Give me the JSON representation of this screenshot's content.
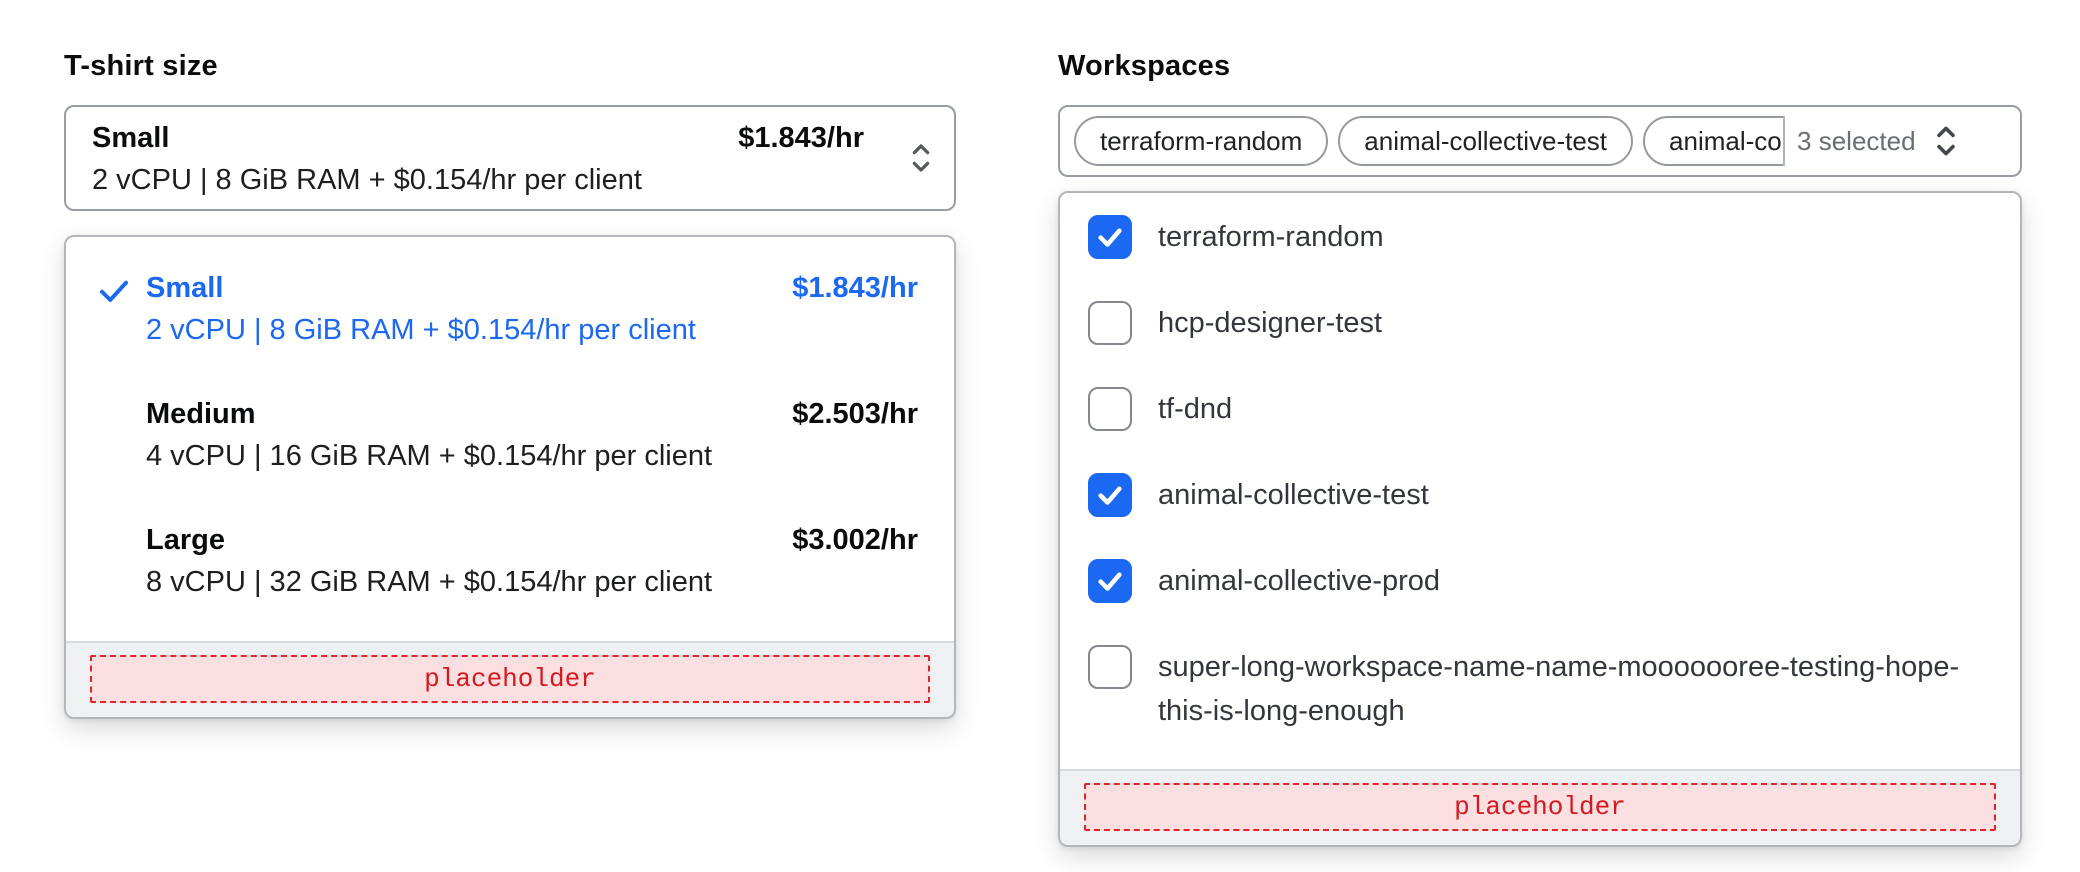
{
  "tshirt": {
    "label": "T-shirt size",
    "trigger": {
      "title": "Small",
      "price": "$1.843/hr",
      "subtitle": "2 vCPU | 8 GiB RAM + $0.154/hr per client"
    },
    "options": [
      {
        "title": "Small",
        "price": "$1.843/hr",
        "subtitle": "2 vCPU | 8 GiB RAM + $0.154/hr per client",
        "selected": true
      },
      {
        "title": "Medium",
        "price": "$2.503/hr",
        "subtitle": "4 vCPU | 16 GiB RAM + $0.154/hr per client",
        "selected": false
      },
      {
        "title": "Large",
        "price": "$3.002/hr",
        "subtitle": "8 vCPU | 32 GiB RAM + $0.154/hr per client",
        "selected": false
      }
    ],
    "footer_placeholder": "placeholder"
  },
  "workspaces": {
    "label": "Workspaces",
    "trigger": {
      "chips": [
        "terraform-random",
        "animal-collective-test",
        "animal-co"
      ],
      "count_label": "3 selected"
    },
    "options": [
      {
        "label": "terraform-random",
        "checked": true
      },
      {
        "label": "hcp-designer-test",
        "checked": false
      },
      {
        "label": "tf-dnd",
        "checked": false
      },
      {
        "label": "animal-collective-test",
        "checked": true
      },
      {
        "label": "animal-collective-prod",
        "checked": true
      },
      {
        "label": "super-long-workspace-name-name-mooooooree-testing-hope-this-is-long-enough",
        "checked": false
      }
    ],
    "footer_placeholder": "placeholder"
  },
  "icons": {
    "trigger_caret": "unfold-more-icon",
    "selected_option": "check-icon",
    "checked_box": "check-icon"
  },
  "colors": {
    "accent_blue": "#1b68f2",
    "placeholder_border_red": "#e0252c",
    "placeholder_text_red": "#d6191f",
    "placeholder_bg_pink": "#fbdfe1",
    "footer_bg": "#eef0f2",
    "trigger_border": "#989ca3",
    "panel_border": "#b3b6bb",
    "muted_text": "#696d74"
  }
}
